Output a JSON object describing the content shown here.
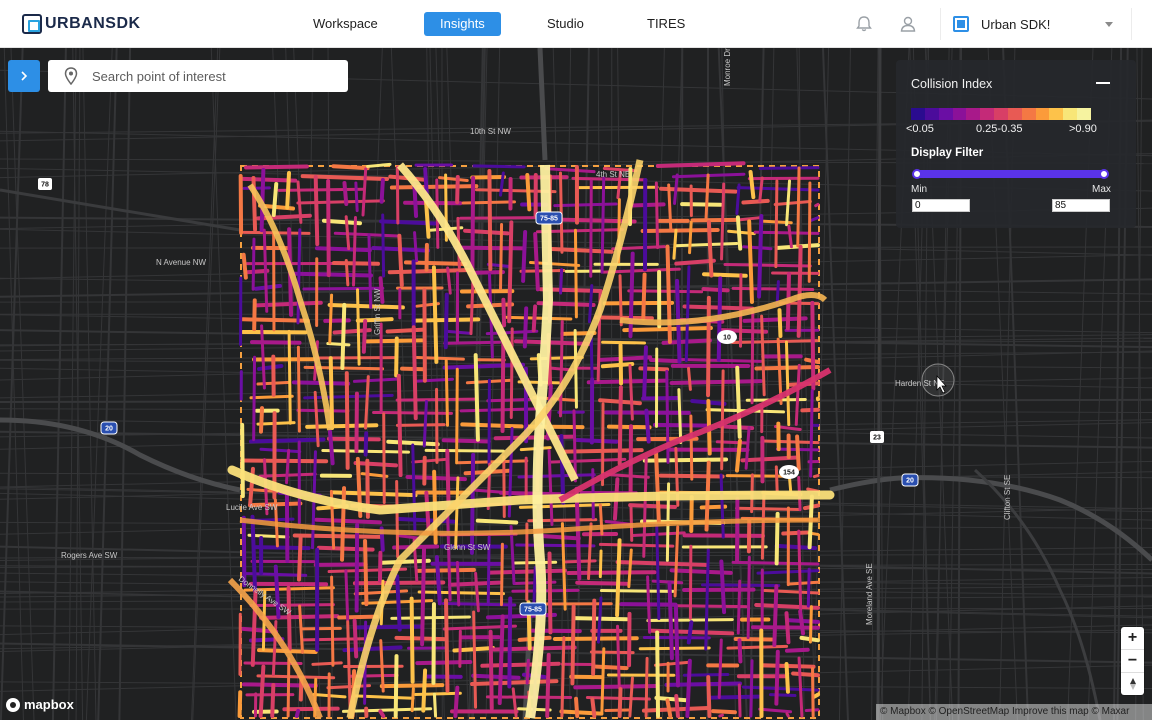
{
  "app": {
    "brand": "URBANSDK"
  },
  "nav": {
    "tabs": [
      {
        "label": "Workspace"
      },
      {
        "label": "Insights"
      },
      {
        "label": "Studio"
      },
      {
        "label": "TIRES"
      }
    ],
    "active_tab": "Insights",
    "org_name": "Urban SDK!"
  },
  "search": {
    "placeholder": "Search point of interest"
  },
  "legend": {
    "title": "Collision Index",
    "ramp_colors": [
      "#2a0c8f",
      "#4b0c9b",
      "#6a0ea4",
      "#8b1199",
      "#a8198a",
      "#c42a78",
      "#d83f66",
      "#e85a54",
      "#f47844",
      "#fb9b3a",
      "#fdc24a",
      "#f8e678",
      "#f6f3a0"
    ],
    "ramp_labels": [
      "<0.05",
      "0.25-0.35",
      ">0.90"
    ],
    "filter_title": "Display Filter",
    "min_label": "Min",
    "max_label": "Max",
    "min_value": "0",
    "max_value": "85"
  },
  "map": {
    "street_labels": [
      "10th St NW",
      "N Avenue NW",
      "Lucile Ave SW",
      "Rogers Ave SW",
      "Donnelly Ave SW",
      "Glenn St SW",
      "Griffin St NW",
      "Monroe Dr",
      "Moreland Ave SE",
      "Clifton St SE",
      "Harden St NE",
      "4th St NE"
    ],
    "shields": [
      "78",
      "75-85",
      "10",
      "20",
      "154",
      "23",
      "20",
      "75-85"
    ]
  },
  "zoom": {
    "in": "+",
    "out": "−"
  },
  "footer": {
    "mapbox": "mapbox",
    "attribution": "© Mapbox © OpenStreetMap  Improve this map © Maxar"
  },
  "colors": {
    "accent": "#2d8fe6",
    "slider": "#5a33e8"
  }
}
